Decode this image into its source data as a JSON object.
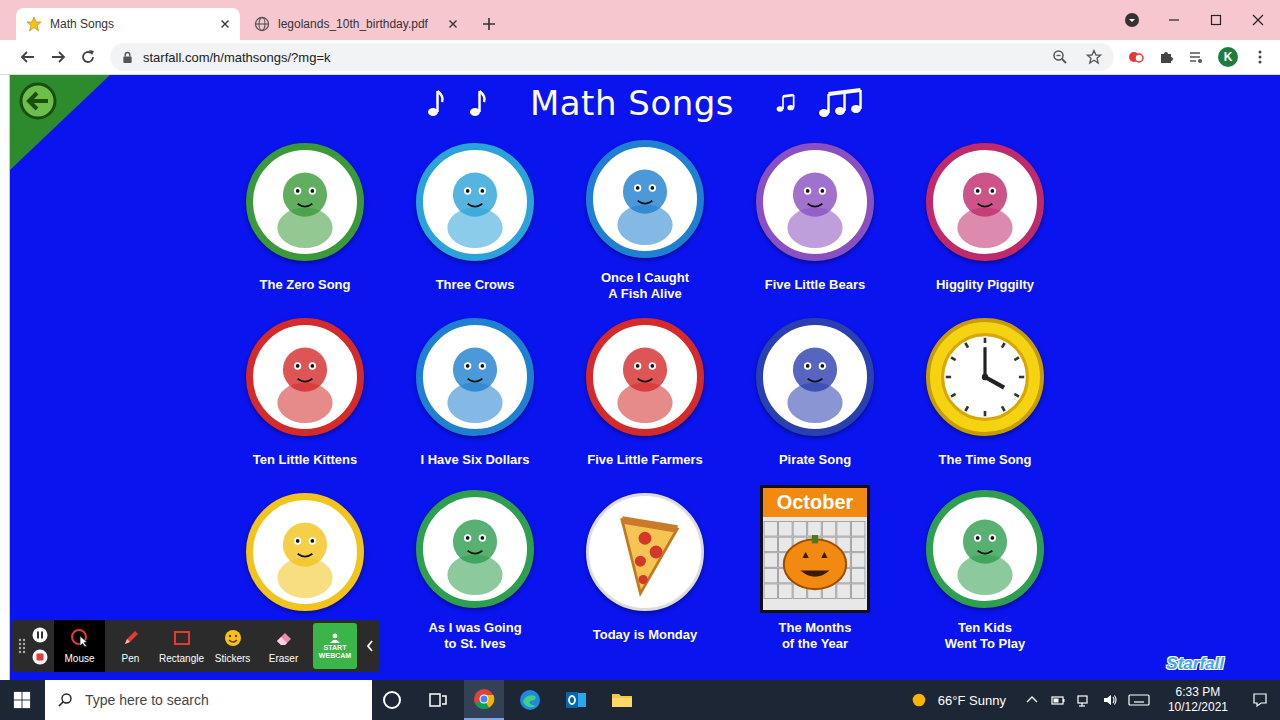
{
  "browser": {
    "tabs": [
      {
        "label": "Math Songs",
        "selected": true
      },
      {
        "label": "legolands_10th_birthday.pdf",
        "selected": false
      }
    ],
    "url": "starfall.com/h/mathsongs/?mg=k",
    "profile": "K"
  },
  "page": {
    "title": "Math Songs",
    "logo": "Starfall",
    "songs": [
      {
        "title": [
          "The Zero Song"
        ],
        "kind": "circle",
        "color": "#3a9a3a"
      },
      {
        "title": [
          "Three Crows"
        ],
        "kind": "circle",
        "color": "#2aa3d8"
      },
      {
        "title": [
          "Once I Caught",
          "A Fish Alive"
        ],
        "kind": "circle",
        "color": "#1f7fd0"
      },
      {
        "title": [
          "Five Little Bears"
        ],
        "kind": "circle",
        "color": "#8a4fc0"
      },
      {
        "title": [
          "Higglity Piggilty"
        ],
        "kind": "circle",
        "color": "#c0296a"
      },
      {
        "title": [
          "Ten Little Kittens"
        ],
        "kind": "circle",
        "color": "#d42a2a"
      },
      {
        "title": [
          "I Have Six Dollars"
        ],
        "kind": "circle",
        "color": "#1f7fd0"
      },
      {
        "title": [
          "Five Little Farmers"
        ],
        "kind": "circle",
        "color": "#d42a2a"
      },
      {
        "title": [
          "Pirate Song"
        ],
        "kind": "circle",
        "color": "#2a3fb0"
      },
      {
        "title": [
          "The Time Song"
        ],
        "kind": "clock",
        "color": "#f5d311"
      },
      {
        "title": [],
        "kind": "circle",
        "color": "#f2c31a"
      },
      {
        "title": [
          "As I was Going",
          "to St. Ives"
        ],
        "kind": "circle",
        "color": "#2e9e4f"
      },
      {
        "title": [
          "Today is Monday"
        ],
        "kind": "plate",
        "color": "#ffffff"
      },
      {
        "title": [
          "The Months",
          "of the Year"
        ],
        "kind": "calendar",
        "color": "#e8e8e8",
        "month": "October"
      },
      {
        "title": [
          "Ten Kids",
          "Went To Play"
        ],
        "kind": "circle",
        "color": "#2e9e4f"
      }
    ]
  },
  "annotation_toolbar": {
    "tools": [
      {
        "label": "Mouse",
        "selected": true
      },
      {
        "label": "Pen",
        "selected": false
      },
      {
        "label": "Rectangle",
        "selected": false
      },
      {
        "label": "Stickers",
        "selected": false
      },
      {
        "label": "Eraser",
        "selected": false
      }
    ],
    "webcam": "START WEBCAM"
  },
  "taskbar": {
    "search_placeholder": "Type here to search",
    "weather": "66°F Sunny",
    "time": "6:33 PM",
    "date": "10/12/2021"
  }
}
